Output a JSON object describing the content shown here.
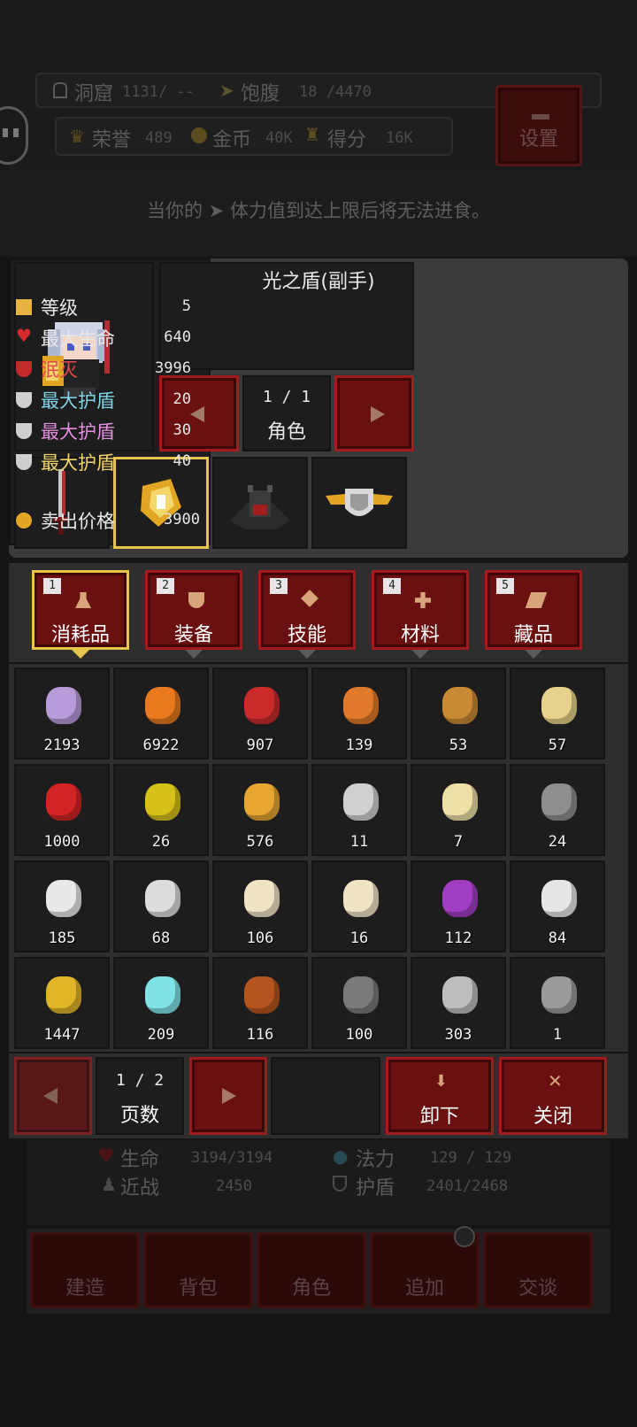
{
  "header": {
    "cave_label": "洞窟",
    "cave_value": "1131/ --",
    "hunger_label": "饱腹",
    "hunger_value": "18 /4470",
    "honor_label": "荣誉",
    "honor_value": "489",
    "gold_label": "金币",
    "gold_value": "40K",
    "score_label": "得分",
    "score_value": "16K",
    "settings_label": "设置"
  },
  "hint": "当你的 ➤ 体力值到达上限后将无法进食。",
  "character_pager": {
    "page": "1 / 1",
    "label": "角色"
  },
  "detail": {
    "title": "光之盾(副手)",
    "rows": [
      {
        "key": "等级",
        "value": "5",
        "color": "#f0f0f0",
        "icon_color": "#e7b441"
      },
      {
        "key": "最大生命",
        "value": "640",
        "color": "#f0f0f0",
        "icon_color": "#d62b2b"
      },
      {
        "key": "泯灭",
        "value": "3996",
        "color": "#e3484e",
        "icon_color": "#c42a2a"
      },
      {
        "key": "最大护盾",
        "value": "20",
        "color": "#7fd3e6",
        "icon_color": "#cfcfcf"
      },
      {
        "key": "最大护盾",
        "value": "30",
        "color": "#e38ee0",
        "icon_color": "#cfcfcf"
      },
      {
        "key": "最大护盾",
        "value": "40",
        "color": "#f0d36a",
        "icon_color": "#cfcfcf"
      }
    ],
    "sell_label": "卖出价格",
    "sell_value": "3900"
  },
  "tabs": [
    {
      "num": "1",
      "label": "消耗品",
      "selected": true
    },
    {
      "num": "2",
      "label": "装备",
      "selected": false
    },
    {
      "num": "3",
      "label": "技能",
      "selected": false
    },
    {
      "num": "4",
      "label": "材料",
      "selected": false
    },
    {
      "num": "5",
      "label": "藏品",
      "selected": false
    }
  ],
  "items": [
    {
      "icon": "turnip-icon",
      "qty": "2193",
      "color": "#b79ad8"
    },
    {
      "icon": "pumpkin-icon",
      "qty": "6922",
      "color": "#e8791f"
    },
    {
      "icon": "cherry-icon",
      "qty": "907",
      "color": "#c92a2a"
    },
    {
      "icon": "burger-icon",
      "qty": "139",
      "color": "#e07a2a"
    },
    {
      "icon": "big-burger-icon",
      "qty": "53",
      "color": "#c98a35"
    },
    {
      "icon": "oil-bottle-icon",
      "qty": "57",
      "color": "#e6d28a"
    },
    {
      "icon": "red-potion-icon",
      "qty": "1000",
      "color": "#d22424"
    },
    {
      "icon": "yellow-flask-icon",
      "qty": "26",
      "color": "#d6c11a"
    },
    {
      "icon": "medal-icon",
      "qty": "576",
      "color": "#e7a532"
    },
    {
      "icon": "sword-medal-icon",
      "qty": "11",
      "color": "#d0d0d0"
    },
    {
      "icon": "jar-icon",
      "qty": "7",
      "color": "#eedfa6"
    },
    {
      "icon": "cloth-roll-icon",
      "qty": "24",
      "color": "#8e8e8e"
    },
    {
      "icon": "crown-icon",
      "qty": "185",
      "color": "#e8e8e8"
    },
    {
      "icon": "bone-icon",
      "qty": "68",
      "color": "#dcdcdc"
    },
    {
      "icon": "scroll-icon",
      "qty": "106",
      "color": "#efe4c4"
    },
    {
      "icon": "scroll-icon",
      "qty": "16",
      "color": "#efe4c4"
    },
    {
      "icon": "purple-potion-icon",
      "qty": "112",
      "color": "#a23ec4"
    },
    {
      "icon": "winged-statue-icon",
      "qty": "84",
      "color": "#e6e6e6"
    },
    {
      "icon": "relic-icon",
      "qty": "1447",
      "color": "#e1b528"
    },
    {
      "icon": "crystal-icon",
      "qty": "209",
      "color": "#7fe2e6"
    },
    {
      "icon": "mushroom-statue-icon",
      "qty": "116",
      "color": "#b4541e"
    },
    {
      "icon": "gate-statue-icon",
      "qty": "100",
      "color": "#7a7a7a"
    },
    {
      "icon": "target-icon",
      "qty": "303",
      "color": "#bdbdbd"
    },
    {
      "icon": "card-icon",
      "qty": "1",
      "color": "#9a9a9a"
    }
  ],
  "pager": {
    "page": "1 / 2",
    "label": "页数"
  },
  "unequip_label": "卸下",
  "close_label": "关闭",
  "bottom_stats": {
    "hp_label": "生命",
    "hp_value": "3194/3194",
    "mp_label": "法力",
    "mp_value": "129 / 129",
    "melee_label": "近战",
    "melee_value": "2450",
    "shield_label": "护盾",
    "shield_value": "2401/2468"
  },
  "nav": [
    "建造",
    "背包",
    "角色",
    "追加",
    "交谈"
  ]
}
